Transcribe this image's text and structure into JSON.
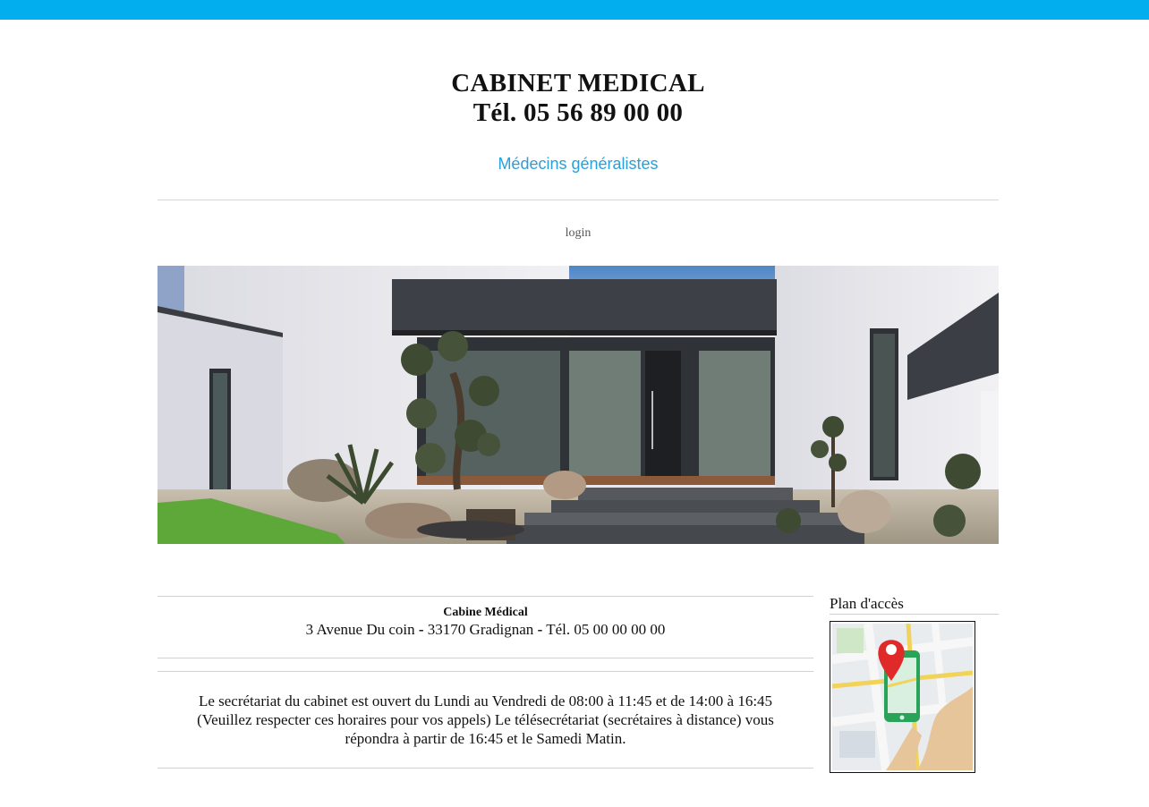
{
  "header": {
    "title": "CABINET MEDICAL",
    "phone": "Tél. 05 56 89 00 00",
    "subtitle": "Médecins généralistes"
  },
  "nav": {
    "login": "login"
  },
  "colors": {
    "top_bar": "#03aeef",
    "link": "#2a9fd8"
  },
  "address": {
    "name": "Cabine Médical",
    "street": "3 Avenue Du coin",
    "sep1": "-",
    "city": "33170 Gradignan",
    "sep2": "-",
    "phone": "Tél. 05 00 00 00 00"
  },
  "hours": {
    "text": "Le secrétariat du cabinet est ouvert du Lundi au Vendredi de 08:00 à 11:45 et de 14:00 à 16:45 (Veuillez respecter ces horaires pour vos appels) Le télésecrétariat (secrétaires à distance) vous répondra à partir de 16:45 et le Samedi Matin."
  },
  "map": {
    "title": "Plan d'accès",
    "icon": "map-location-icon"
  },
  "hero": {
    "image": "building-photo"
  }
}
